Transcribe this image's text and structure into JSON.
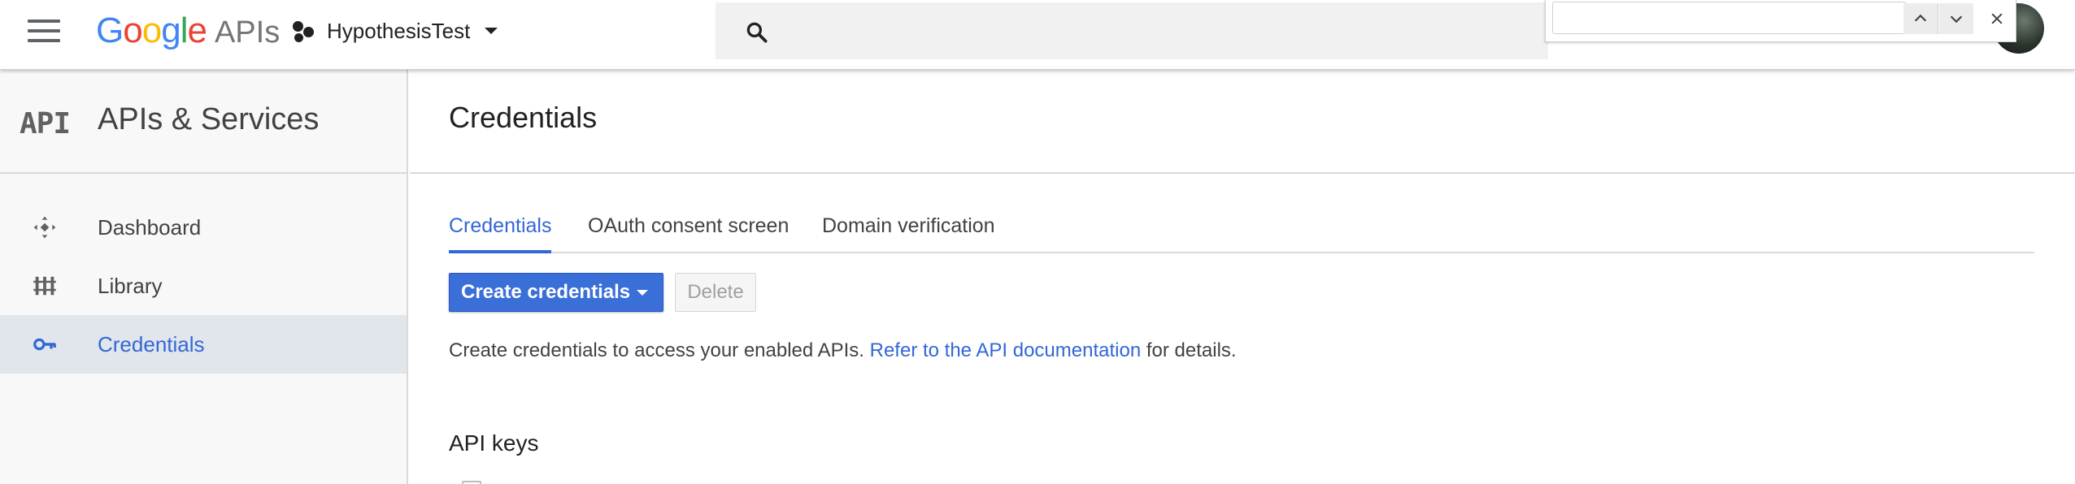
{
  "header": {
    "logo_google": [
      "G",
      "o",
      "o",
      "g",
      "l",
      "e"
    ],
    "logo_apis": "APIs",
    "project_name": "HypothesisTest",
    "icons": {
      "menu": "hamburger-menu-icon",
      "project": "project-dots-icon",
      "search": "search-icon",
      "avatar": "account-avatar"
    }
  },
  "findbar": {
    "value": "",
    "icons": {
      "prev": "chevron-up-icon",
      "next": "chevron-down-icon",
      "close": "close-icon"
    }
  },
  "sidebar": {
    "icon_text": "API",
    "title": "APIs & Services",
    "items": [
      {
        "label": "Dashboard",
        "icon": "dashboard-icon",
        "active": false
      },
      {
        "label": "Library",
        "icon": "library-icon",
        "active": false
      },
      {
        "label": "Credentials",
        "icon": "key-icon",
        "active": true
      }
    ]
  },
  "main": {
    "title": "Credentials",
    "tabs": [
      {
        "label": "Credentials",
        "active": true
      },
      {
        "label": "OAuth consent screen",
        "active": false
      },
      {
        "label": "Domain verification",
        "active": false
      }
    ],
    "create_button": "Create credentials",
    "delete_button": "Delete",
    "info_text_before": "Create credentials to access your enabled APIs.",
    "info_link": "Refer to the API documentation",
    "info_text_after": "for details.",
    "section_title": "API keys"
  },
  "colors": {
    "accent": "#3367d6",
    "primary_button": "#3b6fd8",
    "sidebar_bg": "#f8f8f8",
    "active_nav_bg": "#e1e5ec",
    "search_bg": "#f1f1f1"
  }
}
